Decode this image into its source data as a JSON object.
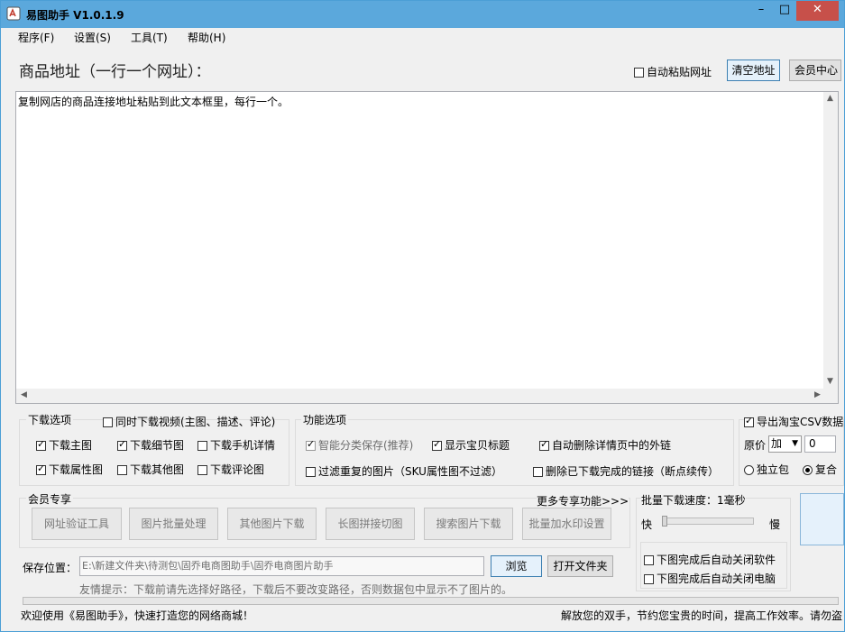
{
  "window": {
    "title": "易图助手 V1.0.1.9",
    "min": "–",
    "max": "□",
    "close": "✕"
  },
  "menu": [
    "程序(F)",
    "设置(S)",
    "工具(T)",
    "帮助(H)"
  ],
  "header": {
    "label": "商品地址（一行一个网址）：",
    "auto_paste": "自动粘贴网址",
    "clear_btn": "清空地址",
    "member_btn": "会员中心"
  },
  "url_box": {
    "placeholder": "复制网店的商品连接地址粘贴到此文本框里，每行一个。"
  },
  "download_options": {
    "title": "下载选项",
    "video": "同时下载视频(主图、描述、评论)",
    "items": [
      {
        "label": "下载主图",
        "checked": true
      },
      {
        "label": "下载细节图",
        "checked": true
      },
      {
        "label": "下载手机详情",
        "checked": false
      },
      {
        "label": "下载属性图",
        "checked": true
      },
      {
        "label": "下载其他图",
        "checked": false
      },
      {
        "label": "下载评论图",
        "checked": false
      }
    ]
  },
  "function_options": {
    "title": "功能选项",
    "smart_save": "智能分类保存(推荐)",
    "show_title": "显示宝贝标题",
    "remove_links": "自动删除详情页中的外链",
    "filter_dup": "过滤重复的图片（SKU属性图不过滤）",
    "delete_done": "删除已下载完成的链接（断点续传）"
  },
  "csv": {
    "export": "导出淘宝CSV数据",
    "price_label": "原价",
    "op": "加",
    "value": "0",
    "independent": "独立包",
    "composite": "复合"
  },
  "member": {
    "title": "会员专享",
    "more": "更多专享功能>>>",
    "buttons": [
      "网址验证工具",
      "图片批量处理",
      "其他图片下载",
      "长图拼接切图",
      "搜索图片下载",
      "批量加水印设置"
    ]
  },
  "speed": {
    "title": "批量下载速度：1毫秒",
    "fast": "快",
    "slow": "慢",
    "close_app": "下图完成后自动关闭软件",
    "close_pc": "下图完成后自动关闭电脑",
    "level_ms": 1
  },
  "save": {
    "label": "保存位置：",
    "path": "E:\\新建文件夹\\待测包\\固乔电商图助手\\固乔电商图片助手",
    "browse": "浏览",
    "open": "打开文件夹",
    "hint": "友情提示：下载前请先选择好路径，下载后不要改变路径，否则数据包中显示不了图片的。"
  },
  "status": {
    "left": "欢迎使用《易图助手》，快速打造您的网络商城！",
    "right": "解放您的双手，节约您宝贵的时间，提高工作效率。请勿盗"
  },
  "colors": {
    "titlebar": "#5ba8dc",
    "close": "#c7504a",
    "accent": "#3c7fb1"
  }
}
